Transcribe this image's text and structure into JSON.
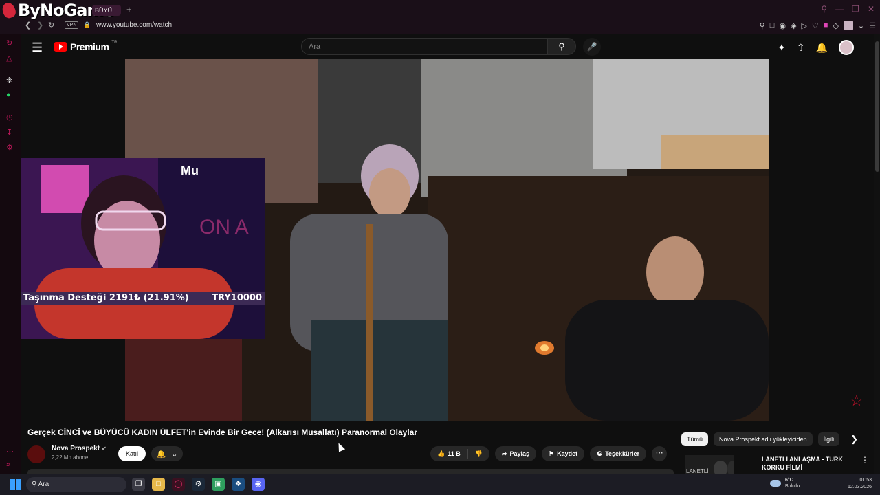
{
  "browser": {
    "brand": "ByNoGame",
    "tab_label": "BÜYÜ",
    "new_tab": "+",
    "vpn": "VPN",
    "url": "www.youtube.com/watch"
  },
  "youtube": {
    "logo_text": "Premium",
    "logo_region": "TR",
    "search_placeholder": "Ara",
    "video_title": "Gerçek CİNCİ ve BÜYÜCÜ KADIN ÜLFET'in Evinde Bir Gece! (Alkarısı Musallatı) Paranormal Olaylar",
    "channel_name": "Nova Prospekt",
    "subscribers": "2,22 Mn abone",
    "join_label": "Katıl",
    "likes": "11 B",
    "share_label": "Paylaş",
    "save_label": "Kaydet",
    "thanks_label": "Teşekkürler",
    "chips": [
      "Tümü",
      "Nova Prospekt adlı yükleyiciden",
      "İlgili"
    ],
    "rec_title": "LANETLİ ANLAŞMA - TÜRK KORKU FİLMİ",
    "rec_thumb_text": "LANETLİ"
  },
  "overlay": {
    "webcam_label": "Mu",
    "webcam_bg_text": "ON A",
    "donation_text": "Taşınma Desteği 2191₺ (21.91%)",
    "donation_goal": "TRY10000",
    "donation_progress": 0.2191
  },
  "taskbar": {
    "search": "Ara",
    "temperature": "6°C",
    "weather": "Bulutlu",
    "time": "01:53",
    "date": "12.03.2026"
  }
}
